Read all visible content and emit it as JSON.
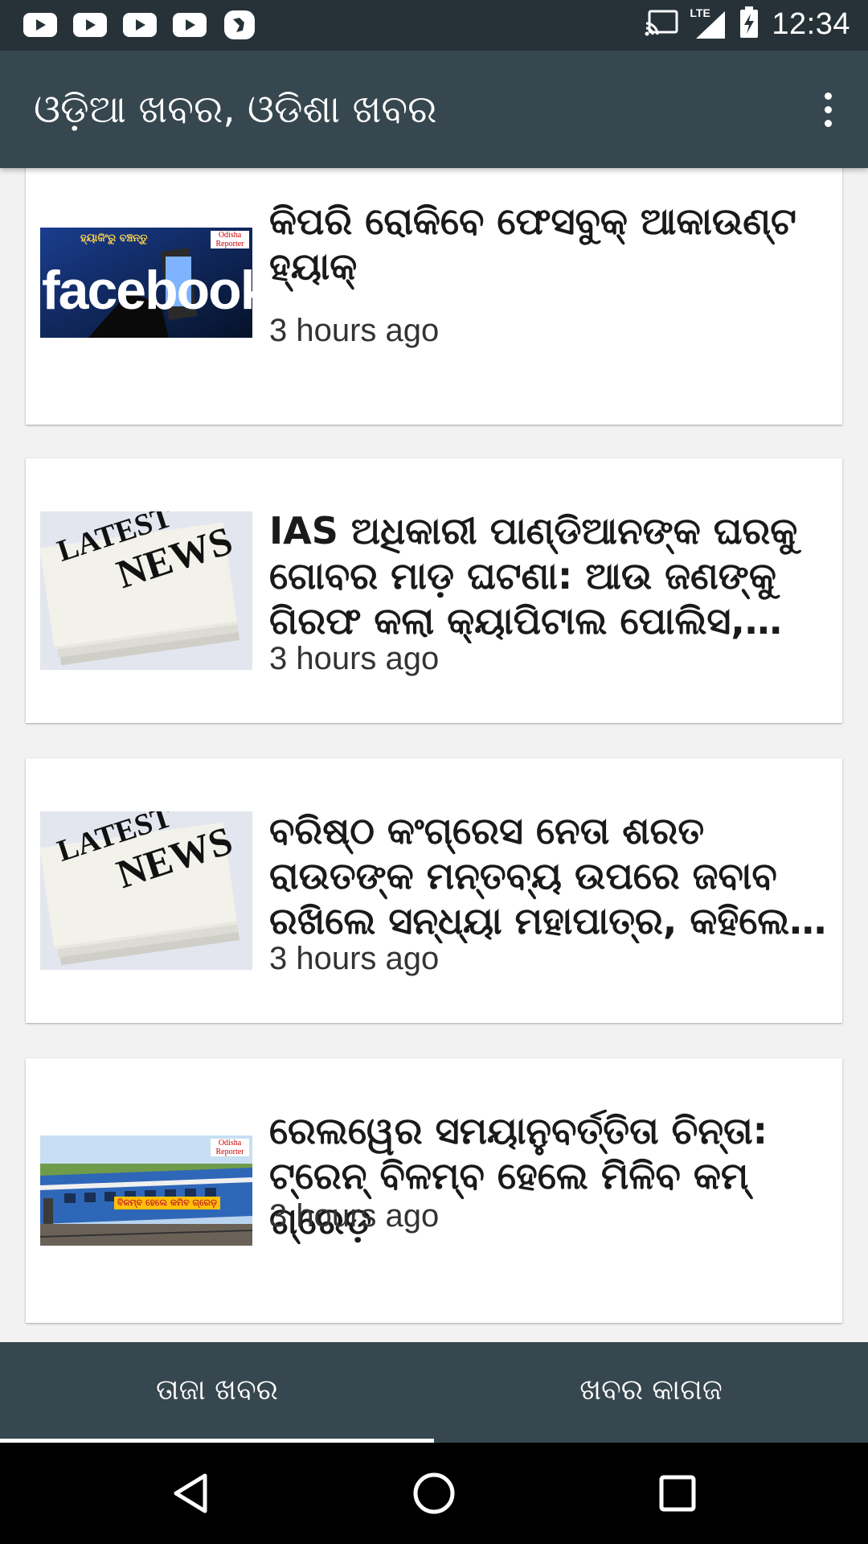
{
  "status_bar": {
    "time": "12:34",
    "network": "LTE",
    "icons": [
      "youtube-icon",
      "youtube-icon",
      "youtube-icon",
      "youtube-icon",
      "bird-app-icon",
      "cast-icon",
      "signal-icon",
      "battery-charging-icon"
    ]
  },
  "app_bar": {
    "title": "ଓଡ଼ିଆ ଖବର, ଓଡିଶା ଖବର",
    "menu_icon": "more-vert-icon"
  },
  "feed": {
    "items": [
      {
        "headline": "କିପରି ରୋକିବେ ଫେସବୁକ୍ ଆକାଉଣ୍ଟ ହ୍ୟାକ୍",
        "time": "3 hours ago",
        "image": {
          "type": "facebook",
          "banner": "ହ୍ୟାକିଂରୁ ବଞ୍ଚନ୍ତୁ",
          "wordmark": "facebook",
          "badge": "Odisha Reporter"
        }
      },
      {
        "headline": "IAS ଅଧିକାରୀ ପାଣ୍ଡିଆନଙ୍କ ଘରକୁ ଗୋବର ମାଡ଼ ଘଟଣା: ଆଉ ଜଣଙ୍କୁ ଗିରଫ କଲା କ୍ୟାପିଟାଲ ପୋଲିସ, ଗିରଫ ସଂ...",
        "time": "3 hours ago",
        "image": {
          "type": "newspaper",
          "line1": "LATEST",
          "line2": "NEWS"
        }
      },
      {
        "headline": "ବରିଷ୍ଠ କଂଗ୍ରେସ ନେତା ଶରତ ରାଉତଙ୍କ ମନ୍ତବ୍ୟ ଉପରେ ଜବାବ ରଖିଲେ ସନ୍ଧ୍ୟା ମହାପାତ୍ର, କହିଲେ- ମୁଁ ଶୃଙ୍ଖଳା କମିଟିର ...",
        "time": "3 hours ago",
        "image": {
          "type": "newspaper",
          "line1": "LATEST",
          "line2": "NEWS"
        }
      },
      {
        "headline": "ରେଲୱେର ସମୟାନୁବର୍ତ୍ତିତା ଚିନ୍ତା: ଟ୍ରେନ୍ ବିଳମ୍ବ ହେଲେ ମିଳିବ କମ୍ ଗ୍ରେଡ଼",
        "time": "3 hours ago",
        "image": {
          "type": "train",
          "caption": "ବିଳମ୍ବ ହେଲେ କମିବ ଗ୍ରେଡ଼",
          "badge": "Odisha Reporter"
        }
      }
    ]
  },
  "tabs": [
    {
      "label": "ତାଜା ଖବର",
      "selected": true
    },
    {
      "label": "ଖବର କାଗଜ",
      "selected": false
    }
  ],
  "nav_bar": {
    "icons": [
      "back-icon",
      "home-icon",
      "recents-icon"
    ]
  },
  "colors": {
    "status_bar": "#263238",
    "app_bar": "#37474f",
    "tab_bar": "#37474f",
    "background": "#f2f2f2"
  }
}
